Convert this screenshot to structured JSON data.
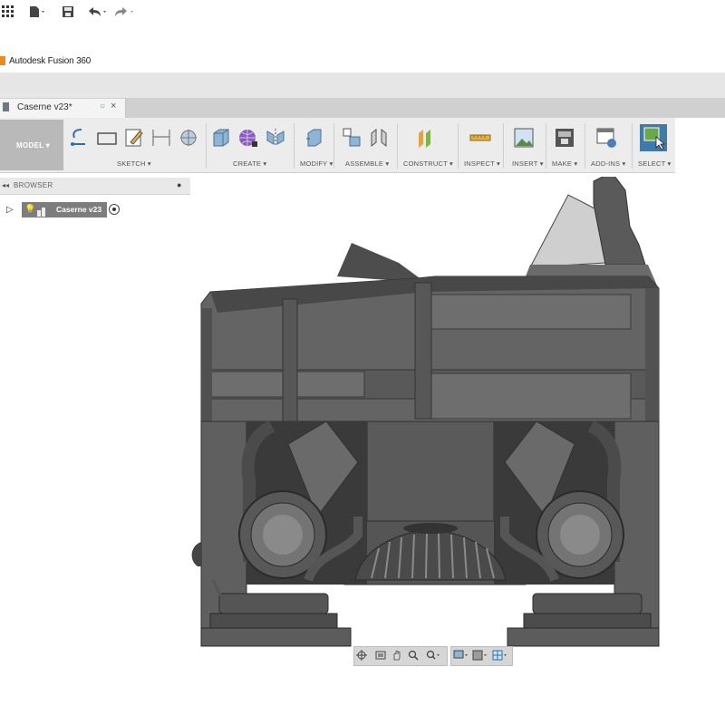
{
  "app": {
    "title": "Autodesk Fusion 360",
    "logo": "fusion-logo-icon",
    "accent": "#f08a1c"
  },
  "quick_access": {
    "items": [
      {
        "name": "data-panel-grid-icon"
      },
      {
        "name": "file-menu-icon"
      },
      {
        "name": "save-icon"
      },
      {
        "name": "undo-icon"
      },
      {
        "name": "redo-icon"
      }
    ]
  },
  "document_tab": {
    "label": "Caserne v23*",
    "status_icon": "sync-status-icon",
    "close": "×"
  },
  "ribbon": {
    "workspace": "MODEL ▾",
    "groups": [
      {
        "label": "SKETCH ▾"
      },
      {
        "label": "CREATE ▾"
      },
      {
        "label": "MODIFY ▾"
      },
      {
        "label": "ASSEMBLE ▾"
      },
      {
        "label": "CONSTRUCT ▾"
      },
      {
        "label": "INSPECT ▾"
      },
      {
        "label": "INSERT ▾"
      },
      {
        "label": "MAKE ▾"
      },
      {
        "label": "ADD-INS ▾"
      },
      {
        "label": "SELECT ▾"
      }
    ]
  },
  "browser": {
    "title": "BROWSER",
    "root": {
      "label": "Caserne v23"
    }
  },
  "colors": {
    "workspace_bg": "#b9b9b9",
    "model_dark": "#4a4a4a",
    "model_mid": "#5f5f5f",
    "model_light": "#7a7a7a",
    "select_active": "#3f7aa8"
  }
}
